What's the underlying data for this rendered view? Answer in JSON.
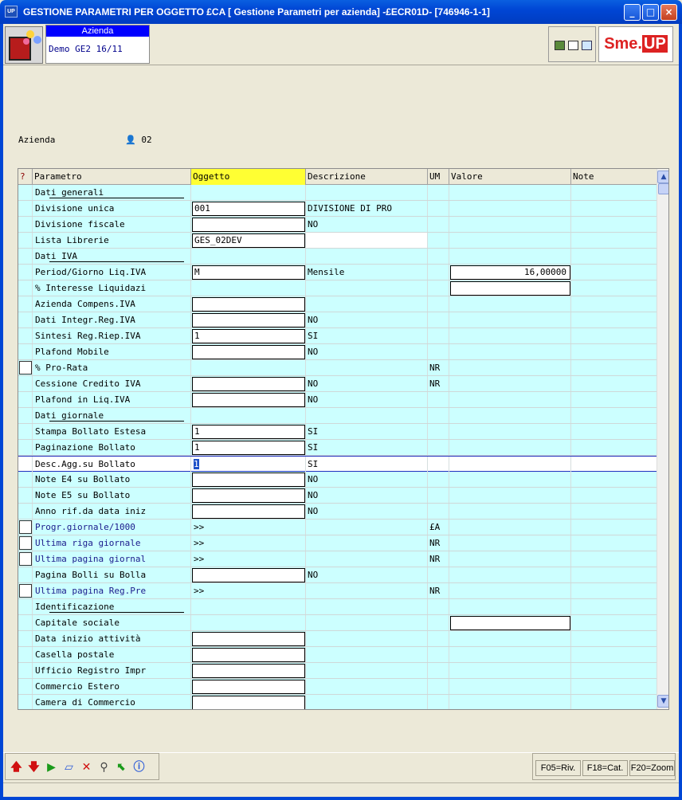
{
  "window": {
    "title": "GESTIONE PARAMETRI PER OGGETTO £CA [ Gestione Parametri per azienda] -£ECR01D- [746946-1-1]",
    "app_icon_label": "UP"
  },
  "header": {
    "azienda_label": "Azienda",
    "azienda_value": "Demo GE2 16/11",
    "brand_left": "Sme.",
    "brand_right": "UP"
  },
  "filter": {
    "label": "Azienda",
    "value": "02"
  },
  "columns": {
    "q": "?",
    "parametro": "Parametro",
    "oggetto": "Oggetto",
    "descrizione": "Descrizione",
    "um": "UM",
    "valore": "Valore",
    "note": "Note"
  },
  "rows": [
    {
      "kind": "section",
      "label": "Dati generali"
    },
    {
      "kind": "row",
      "label": "Divisione unica",
      "oggetto": "001",
      "field": true,
      "desc": "DIVISIONE DI PRO"
    },
    {
      "kind": "row",
      "label": "Divisione fiscale",
      "oggetto": "",
      "field": true,
      "desc": "NO"
    },
    {
      "kind": "row",
      "label": "Lista Librerie",
      "oggetto": "GES_02DEV",
      "field": true,
      "desc": ""
    },
    {
      "kind": "section",
      "label": "Dati IVA"
    },
    {
      "kind": "row",
      "label": "Period/Giorno Liq.IVA",
      "oggetto": "M",
      "field": true,
      "desc": "Mensile",
      "valore": "16,00000",
      "valfield": true
    },
    {
      "kind": "row",
      "label": "% Interesse Liquidazi",
      "oggetto": "",
      "field": false,
      "desc": "",
      "valore": "",
      "valfield": true
    },
    {
      "kind": "row",
      "label": "Azienda Compens.IVA",
      "oggetto": "",
      "field": true,
      "desc": ""
    },
    {
      "kind": "row",
      "label": "Dati Integr.Reg.IVA",
      "oggetto": "",
      "field": true,
      "desc": "NO"
    },
    {
      "kind": "row",
      "label": "Sintesi Reg.Riep.IVA",
      "oggetto": "1",
      "field": true,
      "desc": "SI"
    },
    {
      "kind": "row",
      "label": "Plafond Mobile",
      "oggetto": "",
      "field": true,
      "desc": "NO"
    },
    {
      "kind": "row",
      "label": "% Pro-Rata",
      "oggetto": "",
      "field": false,
      "desc": "",
      "um": "NR",
      "check": true
    },
    {
      "kind": "row",
      "label": "Cessione Credito IVA",
      "oggetto": "",
      "field": true,
      "desc": "NO",
      "um": "NR"
    },
    {
      "kind": "row",
      "label": "Plafond in Liq.IVA",
      "oggetto": "",
      "field": true,
      "desc": "NO"
    },
    {
      "kind": "section",
      "label": "Dati giornale"
    },
    {
      "kind": "row",
      "label": "Stampa Bollato Estesa",
      "oggetto": "1",
      "field": true,
      "desc": "SI"
    },
    {
      "kind": "row",
      "label": "Paginazione Bollato",
      "oggetto": "1",
      "field": true,
      "desc": "SI"
    },
    {
      "kind": "row",
      "label": "Desc.Agg.su Bollato",
      "oggetto": "1",
      "field": false,
      "desc": "SI",
      "selected": true
    },
    {
      "kind": "row",
      "label": "Note E4 su Bollato",
      "oggetto": "",
      "field": true,
      "desc": "NO"
    },
    {
      "kind": "row",
      "label": "Note E5 su Bollato",
      "oggetto": "",
      "field": true,
      "desc": "NO"
    },
    {
      "kind": "row",
      "label": "Anno rif.da data iniz",
      "oggetto": "",
      "field": true,
      "desc": "NO"
    },
    {
      "kind": "row",
      "label": "Progr.giornale/1000",
      "oggetto": ">>",
      "field": false,
      "desc": "",
      "um": "£A",
      "check": true,
      "blue": true
    },
    {
      "kind": "row",
      "label": "Ultima riga giornale",
      "oggetto": ">>",
      "field": false,
      "desc": "",
      "um": "NR",
      "check": true,
      "blue": true
    },
    {
      "kind": "row",
      "label": "Ultima pagina giornal",
      "oggetto": ">>",
      "field": false,
      "desc": "",
      "um": "NR",
      "check": true,
      "blue": true
    },
    {
      "kind": "row",
      "label": "Pagina Bolli su Bolla",
      "oggetto": "",
      "field": true,
      "desc": "NO"
    },
    {
      "kind": "row",
      "label": "Ultima pagina Reg.Pre",
      "oggetto": ">>",
      "field": false,
      "desc": "",
      "um": "NR",
      "check": true,
      "blue": true
    },
    {
      "kind": "section",
      "label": "Identificazione"
    },
    {
      "kind": "row",
      "label": "Capitale sociale",
      "oggetto": "",
      "field": false,
      "desc": "",
      "valore": "",
      "valfield": true
    },
    {
      "kind": "row",
      "label": "Data inizio attività",
      "oggetto": "",
      "field": true,
      "desc": ""
    },
    {
      "kind": "row",
      "label": "Casella postale",
      "oggetto": "",
      "field": true,
      "desc": ""
    },
    {
      "kind": "row",
      "label": "Ufficio Registro Impr",
      "oggetto": "",
      "field": true,
      "desc": ""
    },
    {
      "kind": "row",
      "label": "Commercio Estero",
      "oggetto": "",
      "field": true,
      "desc": ""
    },
    {
      "kind": "row",
      "label": "Camera di Commercio",
      "oggetto": "",
      "field": true,
      "desc": ""
    }
  ],
  "footer": {
    "icons": [
      "arrow-up-icon",
      "arrow-down-icon",
      "play-icon",
      "eraser-icon",
      "delete-icon",
      "search-icon",
      "back-icon",
      "info-icon"
    ],
    "fkeys": [
      "F05=Riv.",
      "F18=Cat.",
      "F20=Zoom"
    ]
  }
}
